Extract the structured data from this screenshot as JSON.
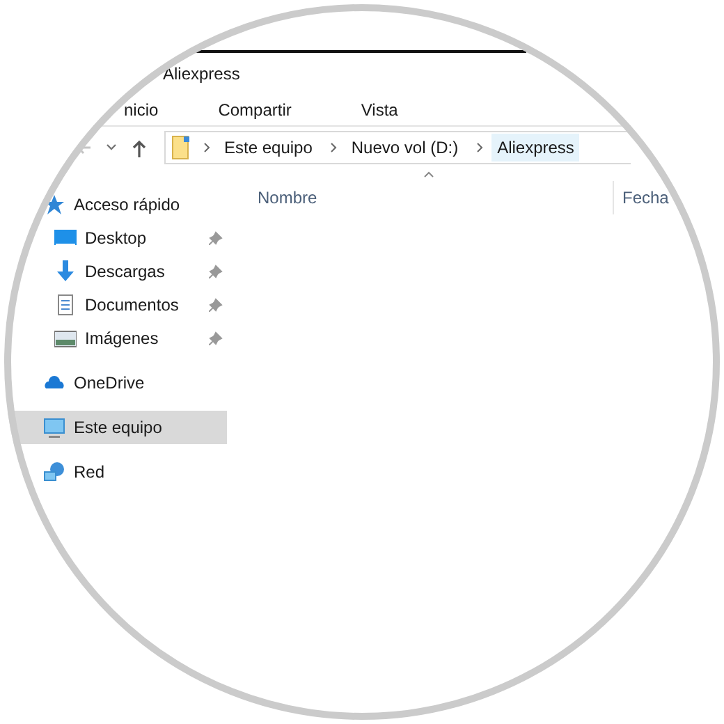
{
  "window": {
    "title": "Aliexpress"
  },
  "ribbon_tabs": [
    "nicio",
    "Compartir",
    "Vista"
  ],
  "address": {
    "path": [
      {
        "label": "Este equipo",
        "selected": false
      },
      {
        "label": "Nuevo vol (D:)",
        "selected": false
      },
      {
        "label": "Aliexpress",
        "selected": true
      }
    ]
  },
  "columns": [
    "Nombre",
    "Fecha"
  ],
  "sidebar": {
    "items": [
      {
        "label": "Acceso rápido",
        "kind": "quick",
        "selected": false,
        "children": [
          {
            "label": "Desktop",
            "kind": "desktop",
            "pinned": true,
            "selected": false
          },
          {
            "label": "Descargas",
            "kind": "downloads",
            "pinned": true,
            "selected": false
          },
          {
            "label": "Documentos",
            "kind": "documents",
            "pinned": true,
            "selected": false
          },
          {
            "label": "Imágenes",
            "kind": "pictures",
            "pinned": true,
            "selected": false
          }
        ]
      },
      {
        "label": "OneDrive",
        "kind": "onedrive",
        "selected": false
      },
      {
        "label": "Este equipo",
        "kind": "pc",
        "selected": true
      },
      {
        "label": "Red",
        "kind": "network",
        "selected": false
      }
    ]
  }
}
